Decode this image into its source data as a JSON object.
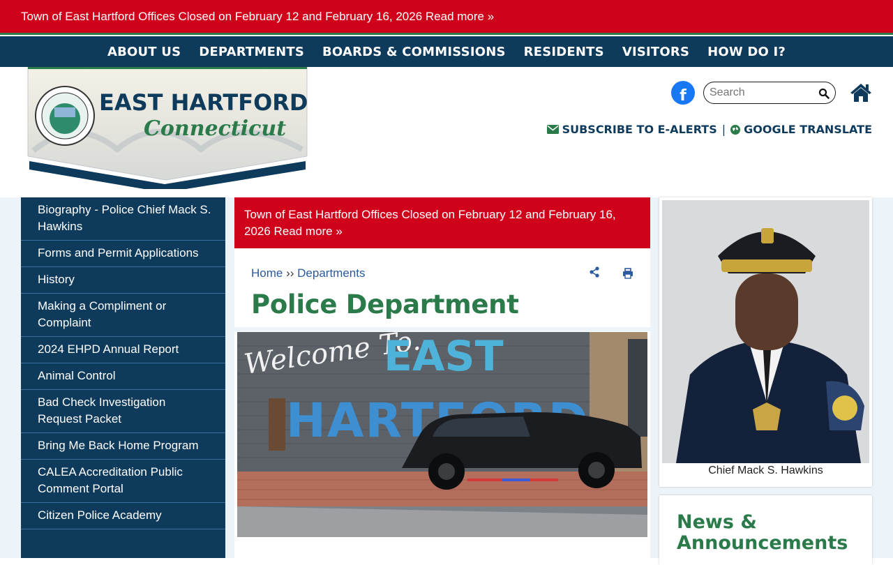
{
  "alert": {
    "text": "Town of East Hartford Offices Closed on February 12 and February 16, 2026 Read more »"
  },
  "nav": [
    {
      "label": "ABOUT US"
    },
    {
      "label": "DEPARTMENTS"
    },
    {
      "label": "BOARDS & COMMISSIONS"
    },
    {
      "label": "RESIDENTS"
    },
    {
      "label": "VISITORS"
    },
    {
      "label": "HOW DO I?"
    }
  ],
  "logo": {
    "line1": "EAST HARTFORD",
    "line2": "Connecticut",
    "seal_text": "TOWN OF EAST HARTFORD · CONNECTICUT"
  },
  "header": {
    "facebook_icon": "facebook-icon",
    "search_placeholder": "Search",
    "subscribe_label": "SUBSCRIBE TO E-ALERTS",
    "separator": "|",
    "translate_label": "GOOGLE TRANSLATE"
  },
  "sidebar": {
    "items": [
      {
        "label": "Biography - Police Chief Mack S. Hawkins"
      },
      {
        "label": "Forms and Permit Applications"
      },
      {
        "label": "History"
      },
      {
        "label": "Making a Compliment or Complaint"
      },
      {
        "label": "2024 EHPD Annual Report"
      },
      {
        "label": "Animal Control"
      },
      {
        "label": "Bad Check Investigation Request Packet"
      },
      {
        "label": "Bring Me Back Home Program"
      },
      {
        "label": "CALEA Accreditation Public Comment Portal"
      },
      {
        "label": "Citizen Police Academy"
      }
    ]
  },
  "main": {
    "alert_text": "Town of East Hartford Offices Closed on February 12 and February 16, 2026 Read more »",
    "breadcrumb": {
      "home": "Home",
      "sep": "››",
      "current": "Departments"
    },
    "title": "Police Department",
    "hero_mural_text_1": "Welcome To..",
    "hero_mural_text_2": "EAST",
    "hero_mural_text_3": "HARTFORD"
  },
  "right": {
    "caption": "Chief Mack S. Hawkins",
    "news_title": "News & Announcements"
  },
  "colors": {
    "alert_red": "#d0021b",
    "navy": "#0e3a5c",
    "green": "#2a7a4a",
    "link_blue": "#2c5a9e"
  }
}
